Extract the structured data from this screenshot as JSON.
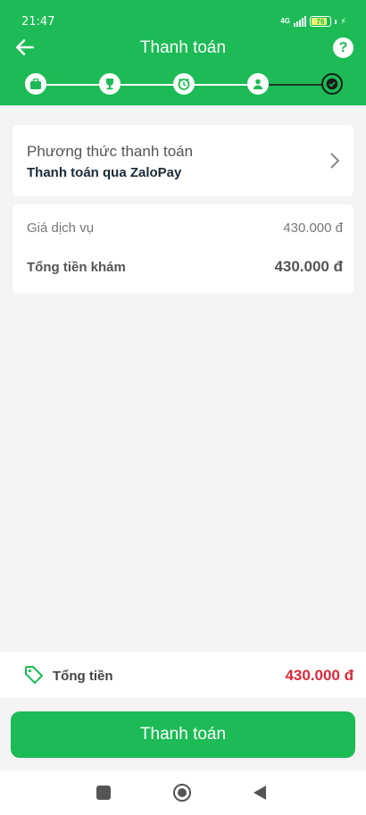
{
  "status": {
    "time": "21:47",
    "network": "4G",
    "battery": "76"
  },
  "header": {
    "title": "Thanh toán",
    "help": "?"
  },
  "steps": [
    {
      "icon": "briefcase-icon",
      "state": "completed"
    },
    {
      "icon": "trophy-icon",
      "state": "completed"
    },
    {
      "icon": "clock-icon",
      "state": "completed"
    },
    {
      "icon": "person-icon",
      "state": "completed"
    },
    {
      "icon": "check-icon",
      "state": "current"
    }
  ],
  "payment_method": {
    "label": "Phương thức thanh toán",
    "value": "Thanh toán qua ZaloPay"
  },
  "summary": {
    "service_label": "Giá dịch vụ",
    "service_value": "430.000 đ",
    "total_label": "Tổng tiền khám",
    "total_value": "430.000 đ"
  },
  "total_bar": {
    "label": "Tổng tiền",
    "value": "430.000 đ"
  },
  "pay_button": {
    "label": "Thanh toán"
  },
  "colors": {
    "primary": "#1cbb55",
    "price": "#d7293a"
  }
}
